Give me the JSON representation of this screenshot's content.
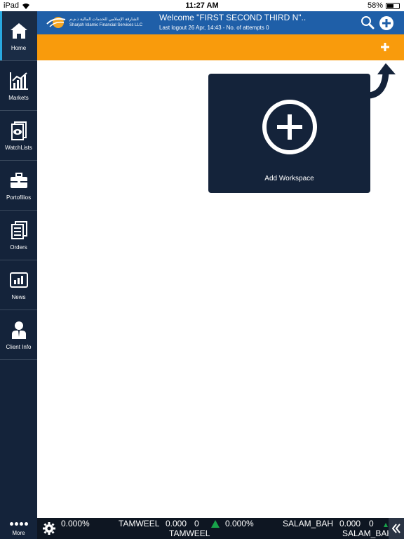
{
  "status": {
    "device": "iPad",
    "time": "11:27 AM",
    "battery": "58%",
    "battery_level": 0.58
  },
  "sidebar": {
    "items": [
      {
        "label": "Home",
        "icon": "home-icon"
      },
      {
        "label": "Markets",
        "icon": "chart-icon"
      },
      {
        "label": "WatchLists",
        "icon": "watchlist-icon"
      },
      {
        "label": "Portofilios",
        "icon": "briefcase-icon"
      },
      {
        "label": "Orders",
        "icon": "orders-icon"
      },
      {
        "label": "News",
        "icon": "news-icon"
      },
      {
        "label": "Client Info",
        "icon": "client-icon"
      }
    ],
    "more_label": "More"
  },
  "header": {
    "logo_line1": "الشارقة الإسلامي للخدمات المالية ذ.م.م",
    "logo_line2": "Sharjah Islamic Financial Services LLC",
    "welcome": "Welcome \"FIRST SECOND THIRD N\"..",
    "last_logout": "Last logout 26 Apr, 14:43  - No. of attempts 0"
  },
  "workspace": {
    "add_label": "Add Workspace"
  },
  "ticker": {
    "items": [
      "0.000%",
      "TAMWEEL",
      "0.000",
      "0",
      "0.000%",
      "SALAM_BAH",
      "0.000",
      "0"
    ],
    "bottom_label": "TAMWEEL",
    "bottom_label_right": "SALAM_BAH"
  },
  "colors": {
    "header": "#1f5fa8",
    "toolbar": "#f99b0c",
    "sidebar": "#14233a",
    "up": "#18a34a"
  }
}
